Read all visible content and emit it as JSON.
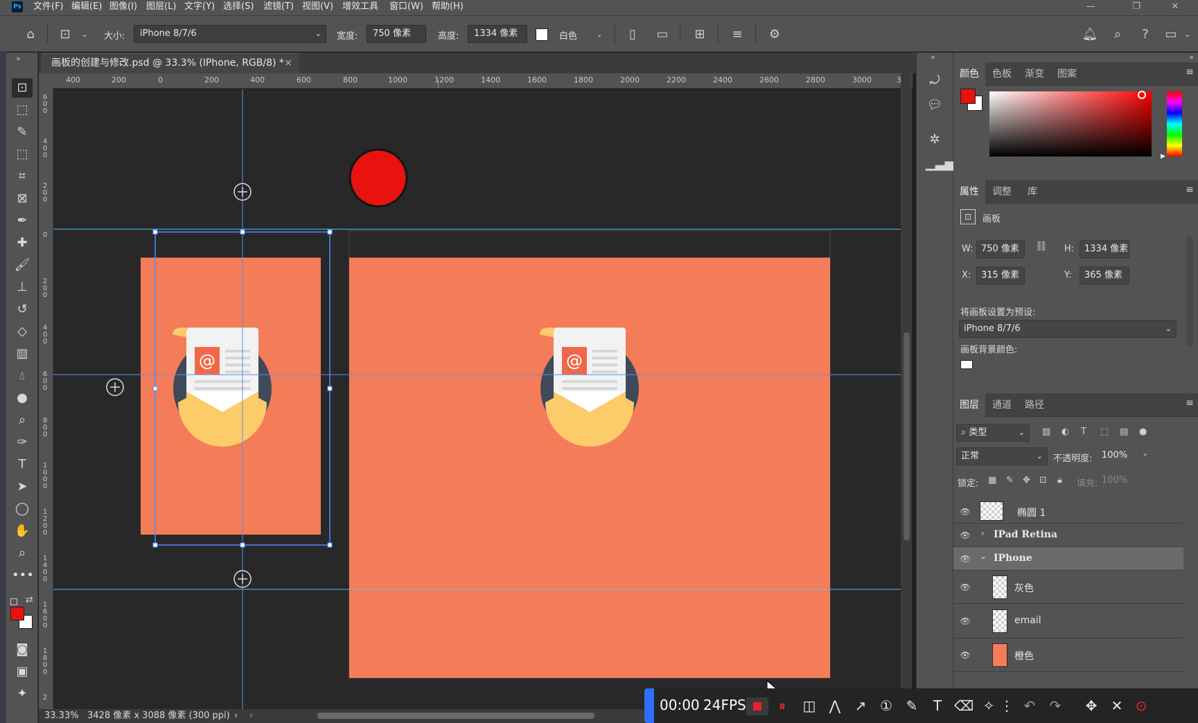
{
  "menu": {
    "logo": "Ps",
    "items": [
      "文件(F)",
      "编辑(E)",
      "图像(I)",
      "图层(L)",
      "文字(Y)",
      "选择(S)",
      "滤镜(T)",
      "视图(V)",
      "增效工具",
      "窗口(W)",
      "帮助(H)"
    ],
    "window_controls": [
      "—",
      "❐",
      "✕"
    ]
  },
  "options": {
    "size_label": "大小:",
    "size_value": "iPhone 8/7/6",
    "width_label": "宽度:",
    "width_value": "750 像素",
    "height_label": "高度:",
    "height_value": "1334 像素",
    "bg_value": "白色"
  },
  "document": {
    "tab_title": "画板的创建与修改.psd @ 33.3% (IPhone, RGB/8) *",
    "tab_close": "×"
  },
  "rulers": {
    "h_labels": [
      "400",
      "200",
      "0",
      "200",
      "400",
      "600",
      "800",
      "1000",
      "1200",
      "1400",
      "1600",
      "1800",
      "2000",
      "2200",
      "2400",
      "2600",
      "2800",
      "3000",
      "3"
    ],
    "v_labels": [
      "600",
      "400",
      "200",
      "0",
      "200",
      "400",
      "600",
      "800",
      "1000",
      "1200",
      "1400",
      "1600",
      "1800",
      "2"
    ]
  },
  "status": {
    "zoom": "33.33%",
    "doc_info": "3428 像素 x 3088 像素 (300 ppi)",
    "arrow": "›"
  },
  "recorder": {
    "time": "00:00",
    "fps": "24FPS"
  },
  "color_panel": {
    "tabs": [
      "颜色",
      "色板",
      "渐变",
      "图案"
    ],
    "foreground": "#e8120e",
    "background": "#ffffff"
  },
  "properties_panel": {
    "tabs": [
      "属性",
      "调整",
      "库"
    ],
    "type_label": "画板",
    "w_label": "W:",
    "w_value": "750 像素",
    "h_label": "H:",
    "h_value": "1334 像素",
    "x_label": "X:",
    "x_value": "315 像素",
    "y_label": "Y:",
    "y_value": "365 像素",
    "preset_label": "将画板设置为预设:",
    "preset_value": "iPhone 8/7/6",
    "bg_color_label": "画板背景颜色:"
  },
  "layers_panel": {
    "tabs": [
      "图层",
      "通道",
      "路径"
    ],
    "filter_label": "类型",
    "blend_mode": "正常",
    "opacity_label": "不透明度:",
    "opacity_value": "100%",
    "lock_label": "锁定:",
    "fill_label": "填充:",
    "fill_value": "100%",
    "layers": [
      {
        "name": "椭圆 1",
        "kind": "shape"
      },
      {
        "name": "IPad Retina",
        "kind": "artboard"
      },
      {
        "name": "IPhone",
        "kind": "artboard"
      },
      {
        "name": "灰色",
        "kind": "layer"
      },
      {
        "name": "email",
        "kind": "layer"
      },
      {
        "name": "橙色",
        "kind": "layer"
      }
    ]
  },
  "colors": {
    "artboard_orange": "#f47c58",
    "red_circle": "#e8120e",
    "guide": "#4fc3f7",
    "selection": "#4a8cff"
  }
}
